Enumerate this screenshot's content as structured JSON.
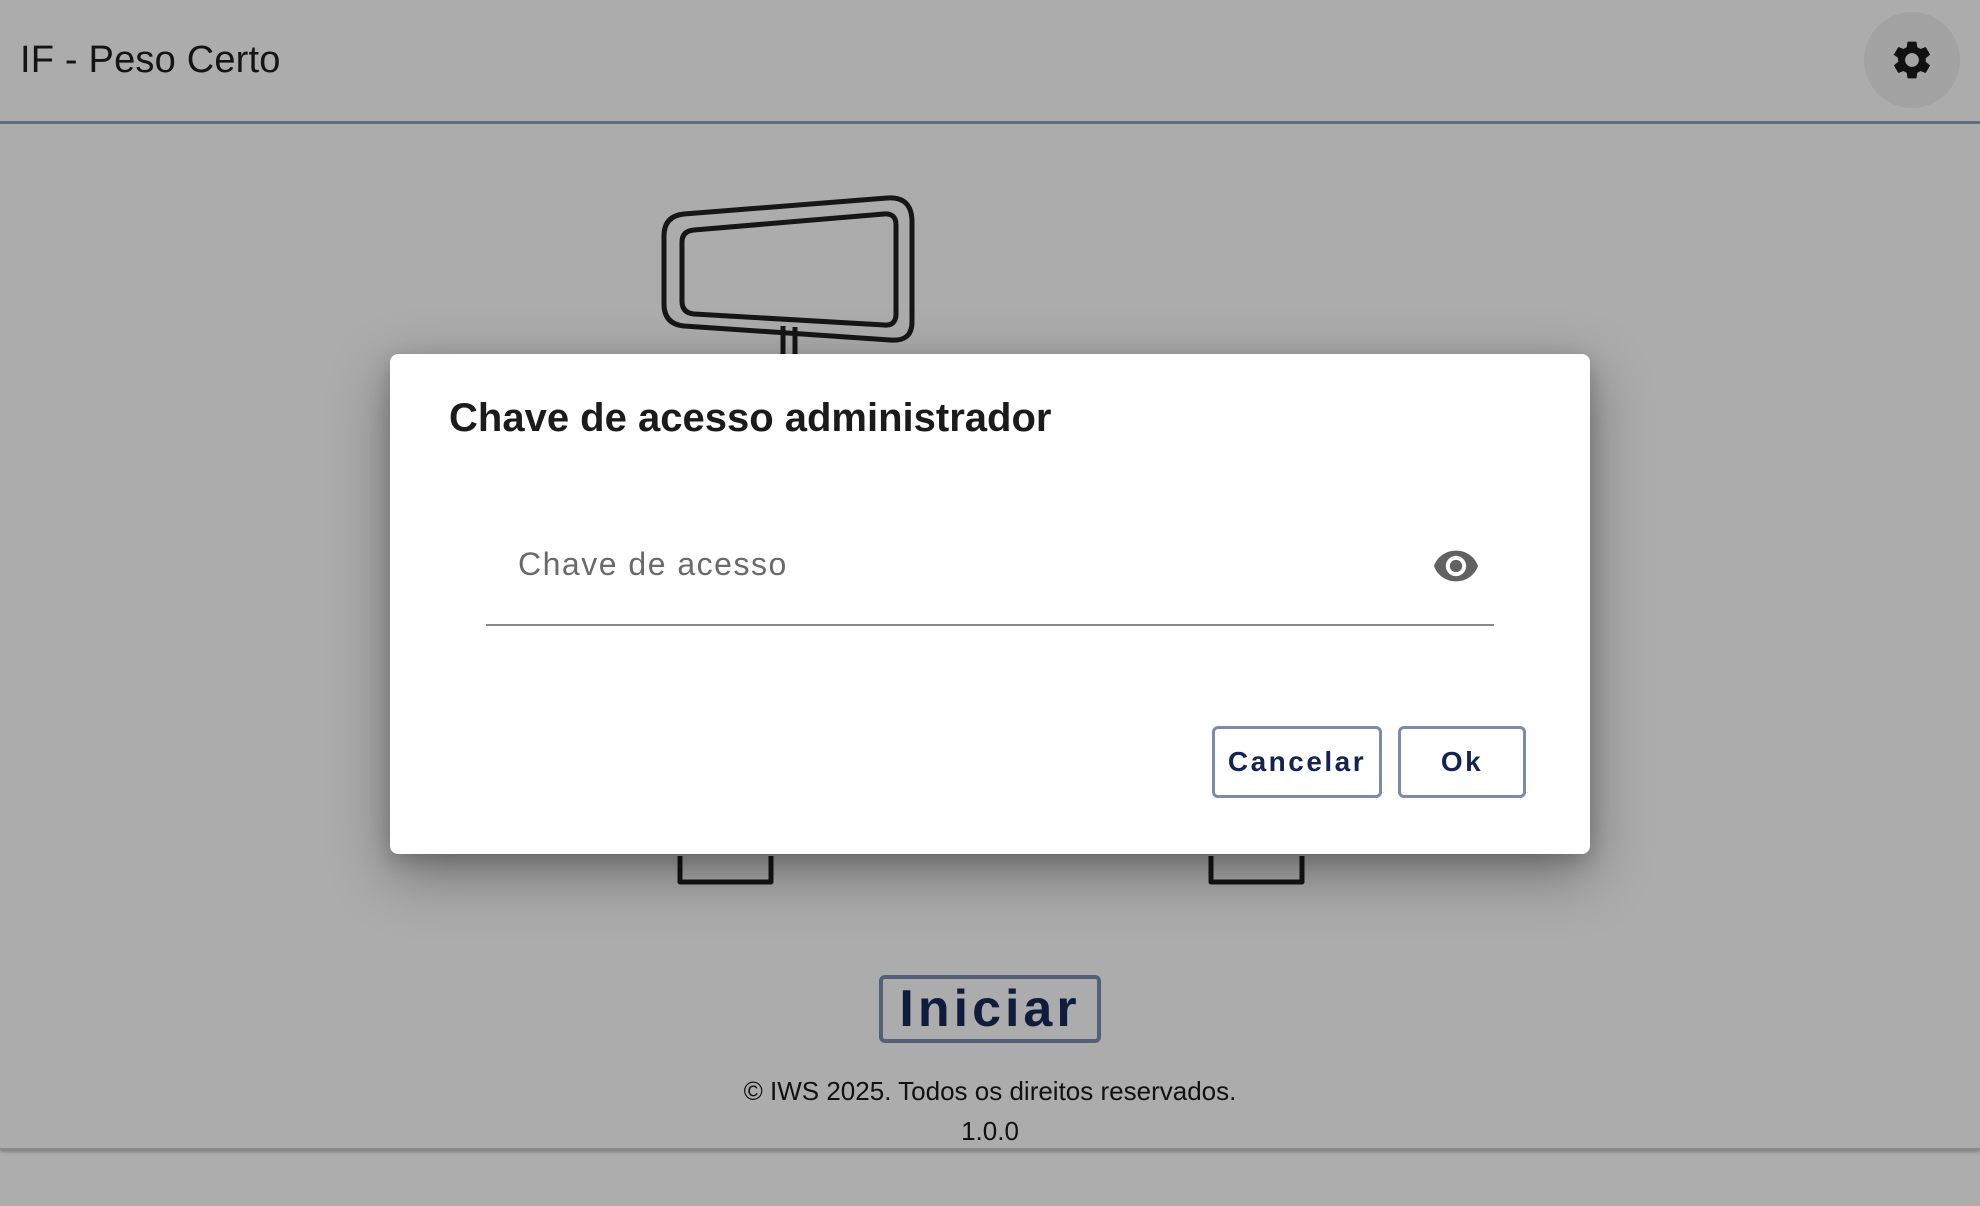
{
  "app": {
    "title": "IF - Peso Certo",
    "settings_icon": "gear-icon"
  },
  "main": {
    "illustration": "scale-icon",
    "start_label": "Iniciar"
  },
  "footer": {
    "copyright": "© IWS 2025. Todos os direitos reservados.",
    "version": "1.0.0"
  },
  "dialog": {
    "title": "Chave de acesso administrador",
    "input": {
      "placeholder": "Chave de acesso",
      "value": "",
      "visibility_icon": "eye-icon"
    },
    "cancel_label": "Cancelar",
    "ok_label": "Ok"
  },
  "colors": {
    "overlay": "#acacac",
    "accent": "#536078",
    "button_text": "#142452",
    "dialog_background": "#ffffff"
  }
}
